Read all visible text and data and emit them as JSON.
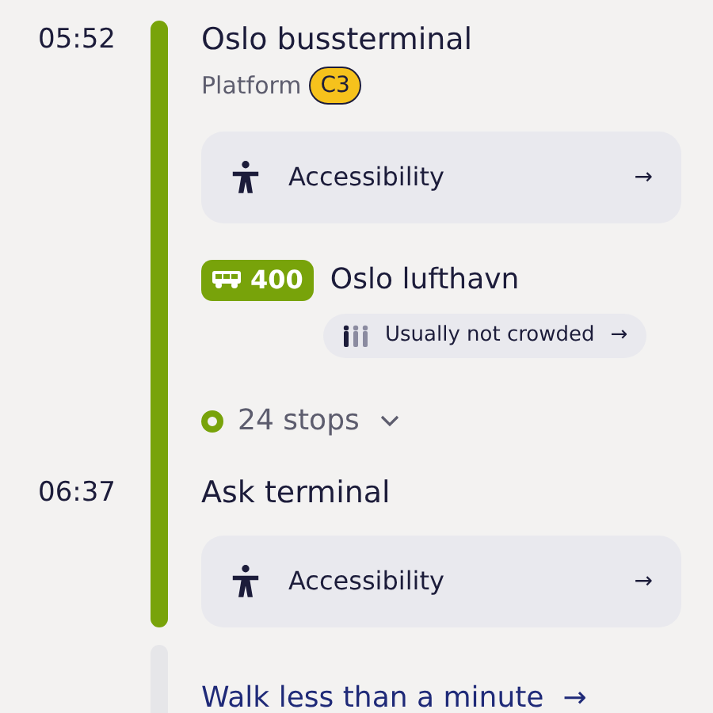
{
  "departure": {
    "time": "05:52",
    "stop": "Oslo bussterminal",
    "platform_label": "Platform",
    "platform": "C3",
    "accessibility": {
      "label": "Accessibility",
      "arrow": "→"
    }
  },
  "line": {
    "number": "400",
    "destination": "Oslo lufthavn",
    "crowding": {
      "label": "Usually not crowded",
      "arrow": "→"
    },
    "stops": "24 stops",
    "expanded": false
  },
  "arrival": {
    "time": "06:37",
    "stop": "Ask terminal",
    "accessibility": {
      "label": "Accessibility",
      "arrow": "→"
    }
  },
  "walk": {
    "label": "Walk less than a minute",
    "arrow": "→"
  }
}
